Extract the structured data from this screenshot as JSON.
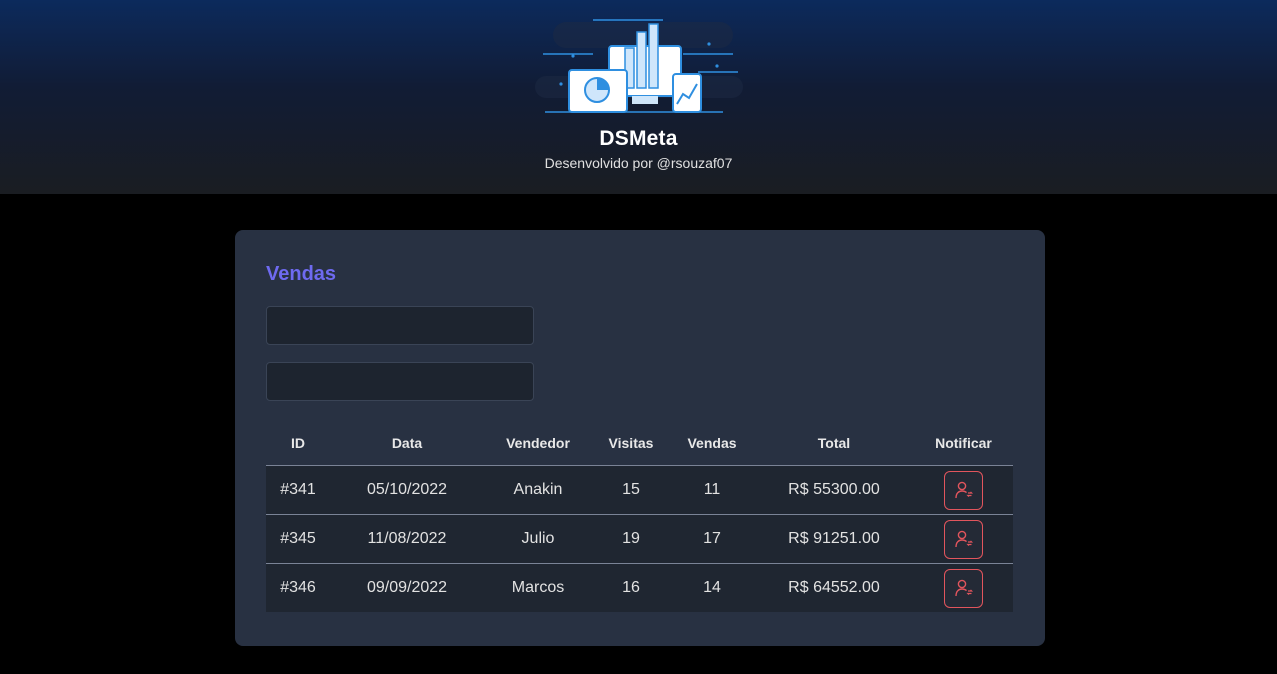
{
  "header": {
    "title": "DSMeta",
    "subtitle": "Desenvolvido por @rsouzaf07",
    "logo_icon": "dashboard-illustration"
  },
  "sales": {
    "title": "Vendas",
    "date_min": {
      "value": "",
      "placeholder": ""
    },
    "date_max": {
      "value": "",
      "placeholder": ""
    },
    "columns": [
      "ID",
      "Data",
      "Vendedor",
      "Visitas",
      "Vendas",
      "Total",
      "Notificar"
    ],
    "rows": [
      {
        "id": "#341",
        "date": "05/10/2022",
        "seller": "Anakin",
        "visits": "15",
        "deals": "11",
        "amount": "R$ 55300.00"
      },
      {
        "id": "#345",
        "date": "11/08/2022",
        "seller": "Julio",
        "visits": "19",
        "deals": "17",
        "amount": "R$ 91251.00"
      },
      {
        "id": "#346",
        "date": "09/09/2022",
        "seller": "Marcos",
        "visits": "16",
        "deals": "14",
        "amount": "R$ 64552.00"
      }
    ],
    "notify_icon": "user-notify-icon"
  },
  "colors": {
    "accent": "#6e6af0",
    "card": "#283142",
    "notify": "#e2555d",
    "header_top": "#0c2a5c"
  }
}
